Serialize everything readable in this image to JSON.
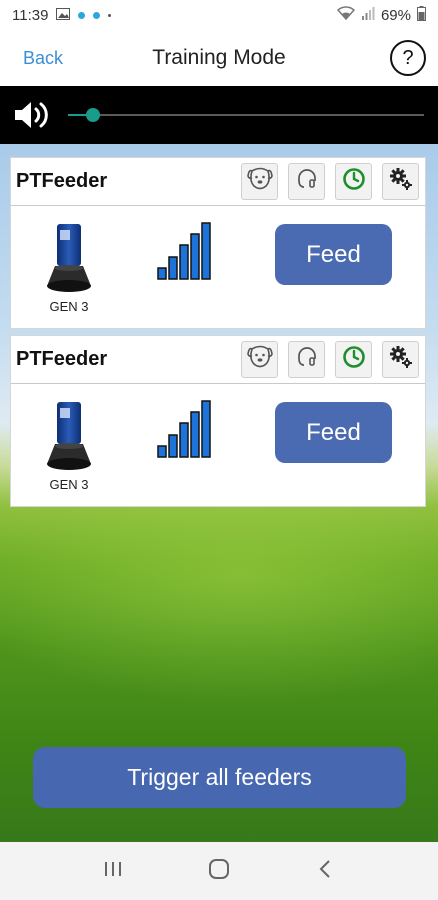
{
  "status_bar": {
    "time": "11:39",
    "battery": "69%"
  },
  "header": {
    "back_label": "Back",
    "title": "Training Mode",
    "help_label": "?"
  },
  "volume": {
    "level": 0.07
  },
  "feeders": [
    {
      "name": "PTFeeder",
      "model_label": "GEN 3",
      "signal_bars": 5,
      "feed_label": "Feed"
    },
    {
      "name": "PTFeeder",
      "model_label": "GEN 3",
      "signal_bars": 5,
      "feed_label": "Feed"
    }
  ],
  "card_icons": [
    "dog-face-icon",
    "headset-icon",
    "clock-icon",
    "gears-icon"
  ],
  "colors": {
    "accent_button": "#4a6ab2",
    "clock_green": "#1f8f2e",
    "signal_blue": "#1e73d9",
    "slider_teal": "#1a9c8c",
    "back_link": "#3b8fd6"
  },
  "trigger_all_label": "Trigger all feeders"
}
